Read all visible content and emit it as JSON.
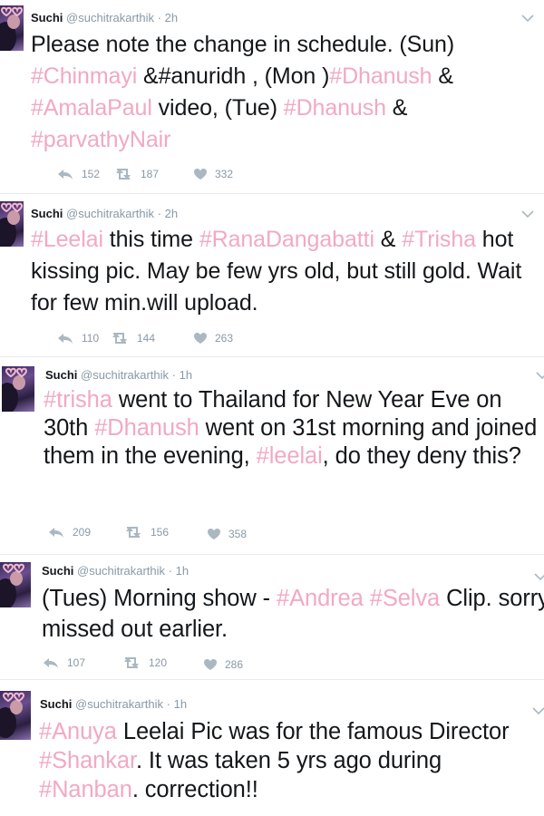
{
  "colors": {
    "hashtag": "#f2a9c2",
    "muted": "#8899a6",
    "separator": "#e6ecf0"
  },
  "tweets": [
    {
      "name": "Suchi",
      "handle": "@suchitrakarthik",
      "time": "2h",
      "text": [
        "Please note the change in schedule. (Sun) ",
        {
          "tag": "#Chinmayi"
        },
        "  &#anuridh , (Mon )",
        {
          "tag": "#Dhanush"
        },
        " & ",
        {
          "tag": "#AmalaPaul"
        },
        " video, (Tue) ",
        {
          "tag": "#Dhanush"
        },
        "  & ",
        {
          "tag": "#parvathyNair"
        }
      ],
      "reply_count": "152",
      "retweet_count": "187",
      "like_count": "332"
    },
    {
      "name": "Suchi",
      "handle": "@suchitrakarthik",
      "time": "2h",
      "text": [
        {
          "tag": "#Leelai"
        },
        " this time ",
        {
          "tag": "#RanaDangabatti"
        },
        " & ",
        {
          "tag": "#Trisha"
        },
        " hot kissing pic. May be few yrs old, but still gold. Wait for few min.will upload."
      ],
      "reply_count": "110",
      "retweet_count": "144",
      "like_count": "263"
    },
    {
      "name": "Suchi",
      "handle": "@suchitrakarthik",
      "time": "1h",
      "text": [
        {
          "tag": "#trisha"
        },
        " went to Thailand for New Year Eve on 30th ",
        {
          "tag": "#Dhanush"
        },
        " went on 31st morning and joined them in the evening, ",
        {
          "tag": "#leelai"
        },
        ", do they deny this?"
      ],
      "reply_count": "209",
      "retweet_count": "156",
      "like_count": "358"
    },
    {
      "name": "Suchi",
      "handle": "@suchitrakarthik",
      "time": "1h",
      "text": [
        "(Tues) Morning show - ",
        {
          "tag": "#Andrea"
        },
        " ",
        {
          "tag": "#Selva"
        },
        " Clip. sorry missed out earlier."
      ],
      "reply_count": "107",
      "retweet_count": "120",
      "like_count": "286"
    },
    {
      "name": "Suchi",
      "handle": "@suchitrakarthik",
      "time": "1h",
      "text": [
        {
          "tag": "#Anuya"
        },
        " Leelai Pic was for the famous Director ",
        {
          "tag": "#Shankar"
        },
        ". It was taken 5 yrs ago during ",
        {
          "tag": "#Nanban"
        },
        ". correction!!"
      ]
    }
  ]
}
